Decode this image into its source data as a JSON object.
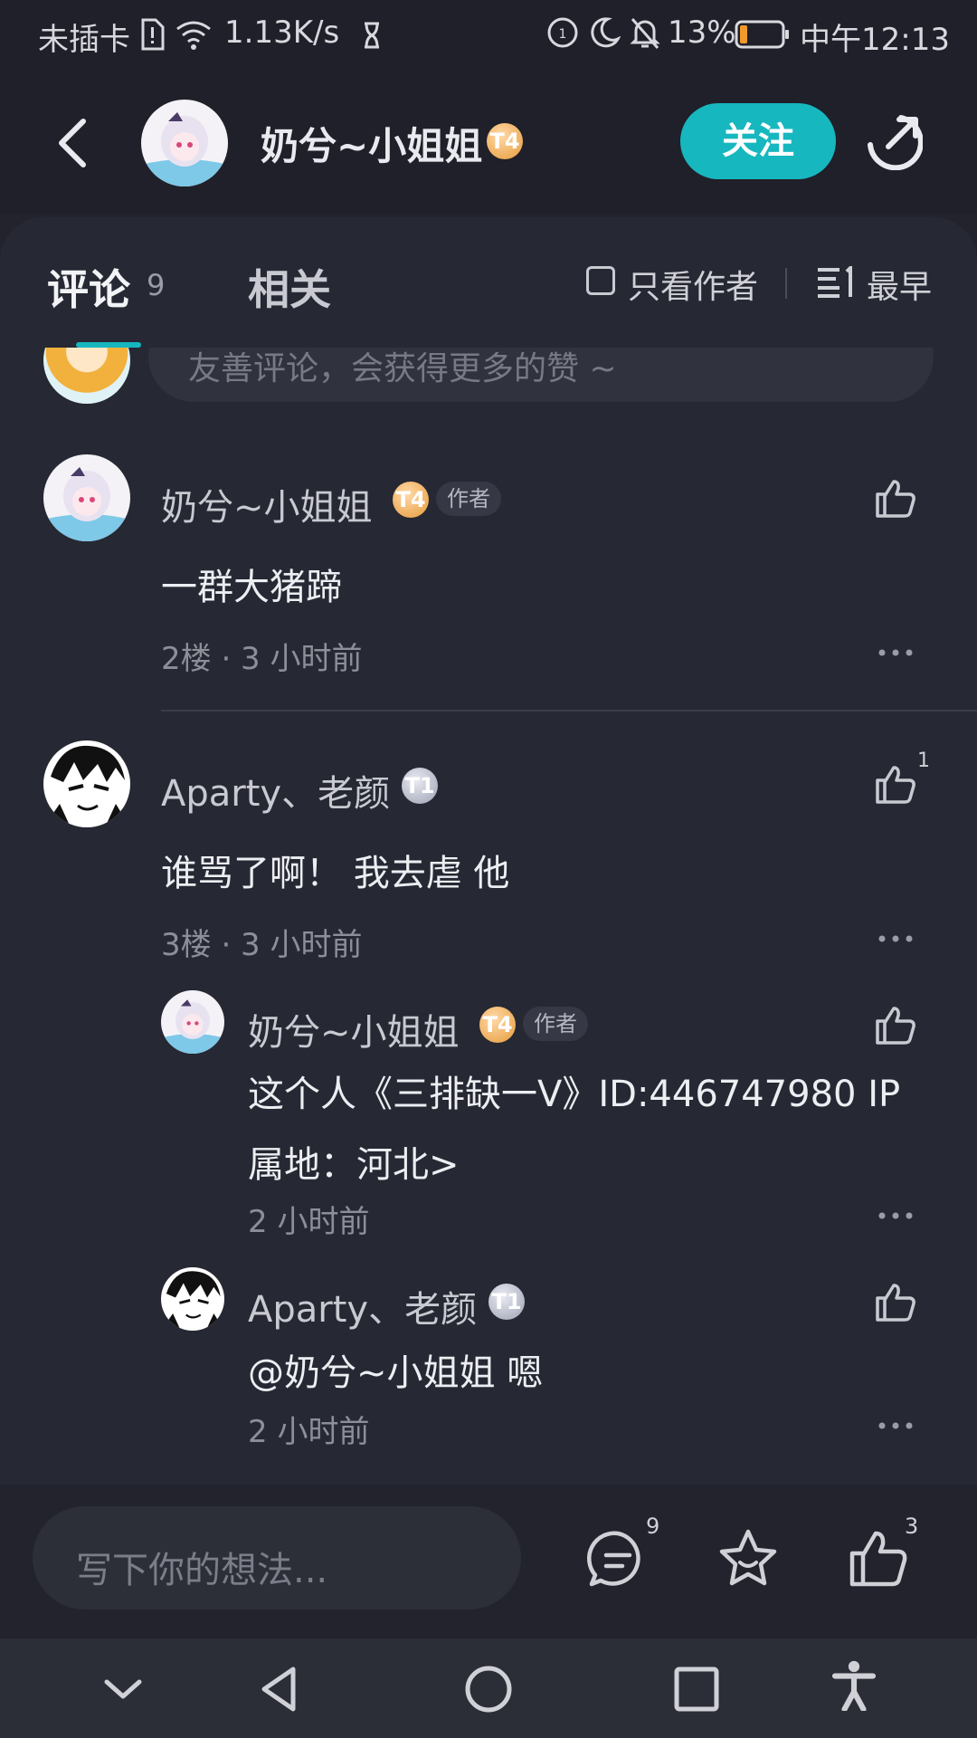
{
  "status_bar": {
    "carrier": "未插卡",
    "speed": "1.13K/s",
    "battery": "13%",
    "time": "中午12:13"
  },
  "header": {
    "username": "奶兮~小姐姐",
    "badge": "T4",
    "follow_label": "关注"
  },
  "tabs": {
    "comments_label": "评论",
    "comments_count": "9",
    "related_label": "相关",
    "author_only_label": "只看作者",
    "sort_label": "最早"
  },
  "comment_input_hint": "友善评论，会获得更多的赞 ~",
  "comments": [
    {
      "author": "奶兮~小姐姐",
      "badge": "T4",
      "author_tag": "作者",
      "text": "一群大猪蹄",
      "meta": "2楼 · 3 小时前"
    },
    {
      "author": "Aparty、老颜",
      "badge": "T1",
      "like_count": "1",
      "text": "谁骂了啊！ 我去虐 他",
      "meta": "3楼 · 3 小时前",
      "replies": [
        {
          "author": "奶兮~小姐姐",
          "badge": "T4",
          "author_tag": "作者",
          "text_line1": "这个人《三排缺一V》ID:446747980 IP",
          "text_line2": "属地：河北>",
          "meta": "2 小时前"
        },
        {
          "author": "Aparty、老颜",
          "badge": "T1",
          "text": "@奶兮~小姐姐  嗯",
          "meta": "2 小时前"
        }
      ]
    }
  ],
  "bottom_bar": {
    "input_placeholder": "写下你的想法...",
    "comment_count": "9",
    "like_count": "3"
  },
  "colors": {
    "accent": "#17b7bf",
    "background": "#22232c",
    "panel": "#262833"
  }
}
